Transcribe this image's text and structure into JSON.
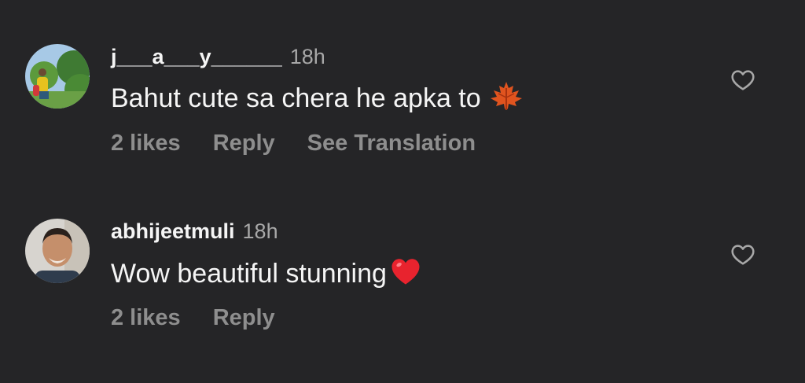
{
  "comments": [
    {
      "username": "j___a___y______",
      "time": "18h",
      "text": "Bahut cute sa chera he apka to",
      "emoji": "maple-leaf",
      "likes": "2 likes",
      "reply": "Reply",
      "translate": "See Translation"
    },
    {
      "username": "abhijeetmuli",
      "time": "18h",
      "text": "Wow beautiful stunning",
      "emoji": "red-heart",
      "likes": "2 likes",
      "reply": "Reply"
    }
  ],
  "colors": {
    "background": "#252527",
    "primary_text": "#f5f5f5",
    "secondary_text": "#a8a8a8",
    "action_text": "#8e8e8e"
  },
  "icons": [
    "heart-outline-icon",
    "maple-leaf-emoji",
    "red-heart-emoji"
  ]
}
